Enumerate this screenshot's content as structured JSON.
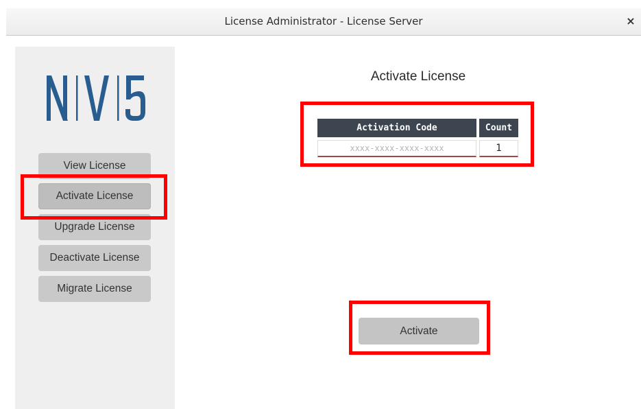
{
  "window": {
    "title": "License Administrator - License Server",
    "close_symbol": "×"
  },
  "sidebar": {
    "logo": {
      "text": "N|V|5",
      "letters": [
        "N",
        "V",
        "5"
      ],
      "color": "#2a5d8f"
    },
    "items": [
      {
        "label": "View License",
        "active": false
      },
      {
        "label": "Activate License",
        "active": true
      },
      {
        "label": "Upgrade License",
        "active": false
      },
      {
        "label": "Deactivate License",
        "active": false
      },
      {
        "label": "Migrate License",
        "active": false
      }
    ]
  },
  "main": {
    "title": "Activate License",
    "table": {
      "headers": {
        "code": "Activation Code",
        "count": "Count"
      },
      "code_value": "",
      "code_placeholder": "xxxx-xxxx-xxxx-xxxx",
      "count_value": "1"
    },
    "activate_label": "Activate"
  },
  "colors": {
    "header_bg": "#3d4650",
    "button_bg": "#c4c4c4",
    "sidebar_bg": "#efefef",
    "highlight": "#ff0000"
  }
}
